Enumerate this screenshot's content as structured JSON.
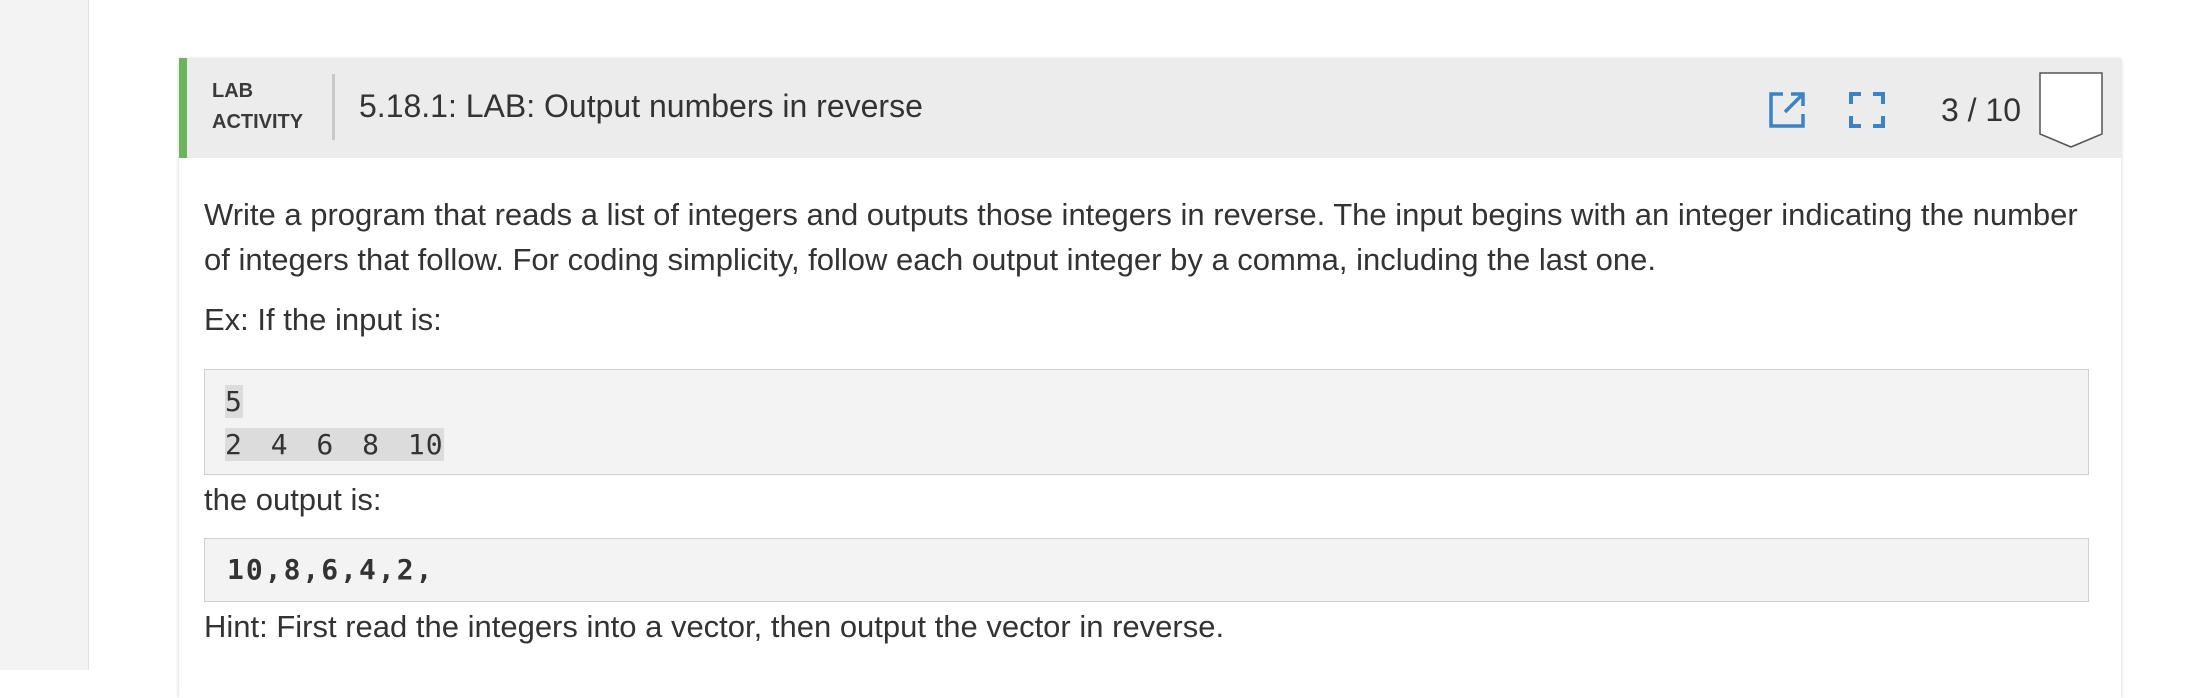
{
  "activity": {
    "type_line1": "LAB",
    "type_line2": "ACTIVITY",
    "title": "5.18.1: LAB: Output numbers in reverse",
    "progress": "3 / 10",
    "accent_color": "#6db55b",
    "icon_color": "#3a83c6",
    "icons": [
      "popout-icon",
      "fullscreen-icon",
      "completion-chevron-icon"
    ]
  },
  "body": {
    "instructions": "Write a program that reads a list of integers and outputs those integers in reverse. The input begins with an integer indicating the number of integers that follow. For coding simplicity, follow each output integer by a comma, including the last one.",
    "example_intro": "Ex: If the input is:",
    "example_input": [
      "5",
      "2 4 6 8 10"
    ],
    "output_intro": "the output is:",
    "example_output": "10,8,6,4,2,",
    "hint": "Hint: First read the integers into a vector, then output the vector in reverse."
  }
}
